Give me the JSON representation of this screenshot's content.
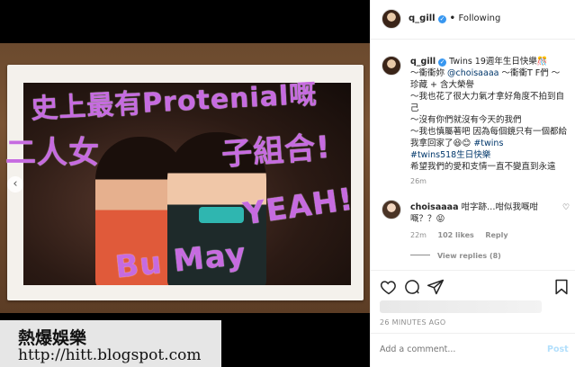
{
  "photo": {
    "scribbles": [
      "史上最有Protenial嘅",
      "二人女",
      "子組合!",
      "YEAH!",
      "Bu May"
    ],
    "nav_arrow": "‹",
    "watermark": {
      "line1": "熱爆娛樂",
      "line2": "http://hitt.blogspot.com"
    }
  },
  "header": {
    "username": "q_gill",
    "verified_mark": "✓",
    "separator": "•",
    "follow_label": "Following"
  },
  "caption": {
    "username": "q_gill",
    "text_1": " Twins 19週年生日快樂🎊",
    "line_2": "～衝衝妳 ",
    "mention": "@choisaaaa",
    "line_2b": " ～衝衝T F們 ～",
    "line_3": "珍藏 + 含大榮譽",
    "line_4": "～我也花了很大力氣才拿好角度不拍到自己",
    "line_5": "～沒有你們就沒有今天的我們",
    "line_6": "～我也慎屬著吧 因為每個鏡只有一個都給我拿回家了😆😊 ",
    "tag_1": "#twins",
    "tag_2": "#twins518生日快樂",
    "line_8": "希望我們的愛和支情一直不變直到永遠",
    "time": "26m"
  },
  "comment": {
    "username": "choisaaaa",
    "text": " 咁字跡…咁似我嘅咁嘅？？😝",
    "time": "22m",
    "likes": "102 likes",
    "reply": "Reply",
    "view_replies": "View replies (8)"
  },
  "post_time": "26 MINUTES AGO",
  "add_comment": {
    "placeholder": "Add a comment...",
    "post_label": "Post"
  },
  "icons": [
    "heart-icon",
    "comment-icon",
    "share-icon",
    "bookmark-icon"
  ]
}
